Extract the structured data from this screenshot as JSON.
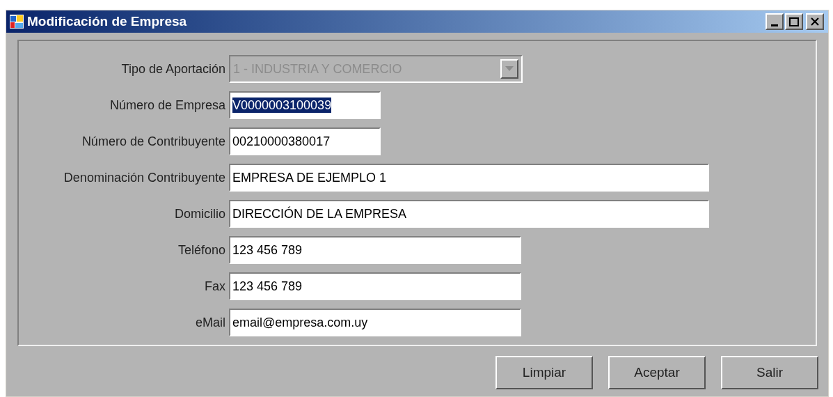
{
  "window": {
    "title": "Modificación de Empresa"
  },
  "fields": [
    {
      "label": "Tipo de Aportación",
      "kind": "combo",
      "value": "1 - INDUSTRIA Y COMERCIO",
      "disabled": true
    },
    {
      "label": "Número de Empresa",
      "kind": "text",
      "value": "V0000003100039",
      "disabled": false,
      "selected": true
    },
    {
      "label": "Número de Contribuyente",
      "kind": "text",
      "value": "00210000380017",
      "disabled": false,
      "selected": false
    },
    {
      "label": "Denominación Contribuyente",
      "kind": "text",
      "value": "EMPRESA DE EJEMPLO 1",
      "disabled": false,
      "selected": false
    },
    {
      "label": "Domicilio",
      "kind": "text",
      "value": "DIRECCIÓN DE LA EMPRESA",
      "disabled": false,
      "selected": false
    },
    {
      "label": "Teléfono",
      "kind": "text",
      "value": "123 456 789",
      "disabled": false,
      "selected": false
    },
    {
      "label": "Fax",
      "kind": "text",
      "value": "123 456 789",
      "disabled": false,
      "selected": false
    },
    {
      "label": "eMail",
      "kind": "text",
      "value": "email@empresa.com.uy",
      "disabled": false,
      "selected": false
    }
  ],
  "buttons": [
    "Limpiar",
    "Aceptar",
    "Salir"
  ]
}
